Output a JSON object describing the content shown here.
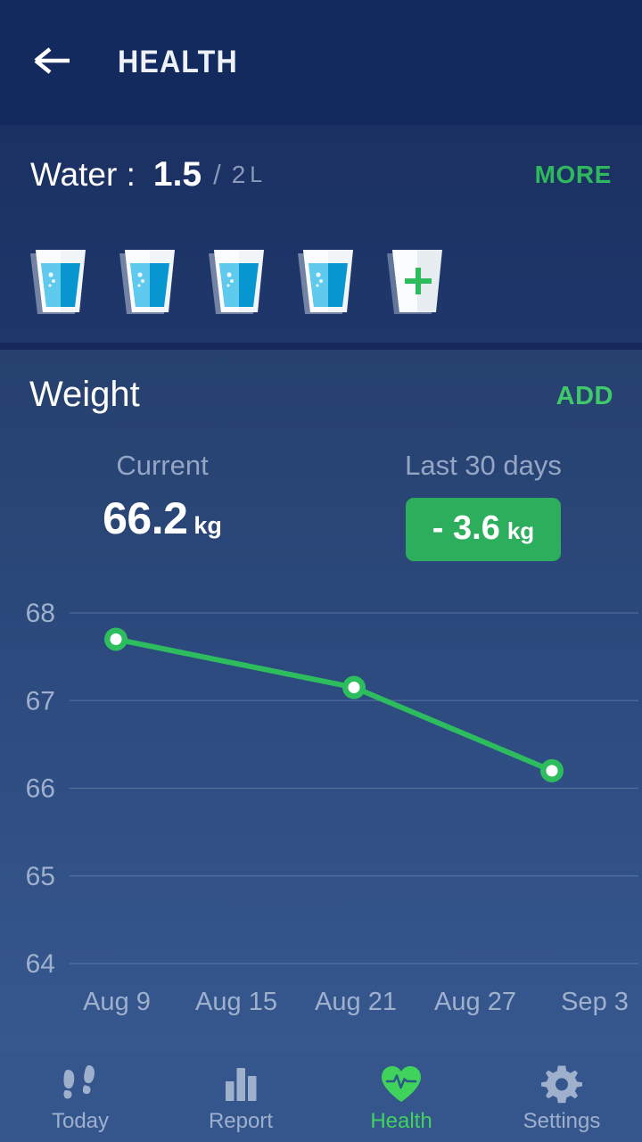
{
  "header": {
    "back_icon": "arrow-left-icon",
    "title": "HEALTH"
  },
  "water": {
    "label": "Water :",
    "current": "1.5",
    "separator": "/",
    "goal": "2",
    "unit": "L",
    "more_label": "MORE",
    "glasses": [
      {
        "state": "full"
      },
      {
        "state": "full"
      },
      {
        "state": "full"
      },
      {
        "state": "full"
      },
      {
        "state": "empty",
        "icon": "plus-icon"
      }
    ]
  },
  "weight": {
    "title": "Weight",
    "add_label": "ADD",
    "current_caption": "Current",
    "current_value": "66.2",
    "current_unit": "kg",
    "delta_caption": "Last 30 days",
    "delta_value": "- 3.6",
    "delta_unit": "kg",
    "delta_color": "#2cae5c"
  },
  "chart_data": {
    "type": "line",
    "title": "",
    "xlabel": "",
    "ylabel": "",
    "ylim": [
      64,
      68.4
    ],
    "yticks": [
      68,
      67,
      66,
      65,
      64
    ],
    "ytick_labels": [
      "68",
      "67",
      "66",
      "65",
      "64"
    ],
    "xtick_labels": [
      "Aug 9",
      "Aug 15",
      "Aug 21",
      "Aug 27",
      "Sep 3"
    ],
    "grid": true,
    "legend": "none",
    "line_color": "#2dbd5e",
    "point_fill": "#ffffff",
    "series": [
      {
        "name": "Weight",
        "x": [
          "Aug 9",
          "Aug 20",
          "Aug 29"
        ],
        "values": [
          67.7,
          67.15,
          66.2
        ]
      }
    ]
  },
  "bottom_nav": {
    "items": [
      {
        "label": "Today",
        "icon": "footprints-icon",
        "active": false
      },
      {
        "label": "Report",
        "icon": "bar-chart-icon",
        "active": false
      },
      {
        "label": "Health",
        "icon": "heart-pulse-icon",
        "active": true
      },
      {
        "label": "Settings",
        "icon": "gear-icon",
        "active": false
      }
    ]
  },
  "colors": {
    "header_bg": "#122a5e",
    "water_bg": "#1d3365",
    "weight_bg_top": "#26416e",
    "weight_bg_bottom": "#36588f",
    "accent_green": "#2fb95c",
    "active_green": "#3fd35c",
    "muted_text": "#95a6c4"
  }
}
